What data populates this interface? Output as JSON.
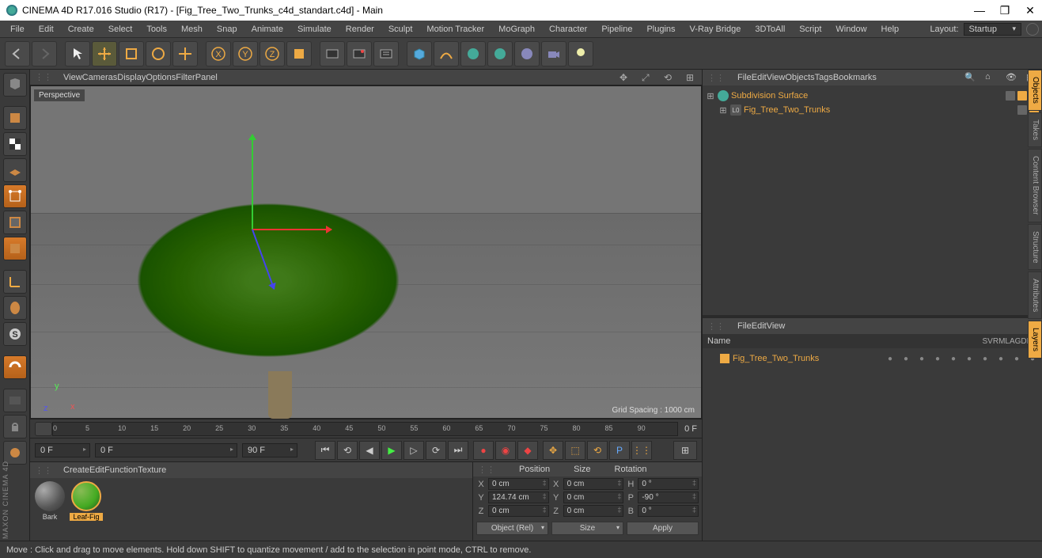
{
  "title": "CINEMA 4D R17.016 Studio (R17) - [Fig_Tree_Two_Trunks_c4d_standart.c4d] - Main",
  "menu": [
    "File",
    "Edit",
    "Create",
    "Select",
    "Tools",
    "Mesh",
    "Snap",
    "Animate",
    "Simulate",
    "Render",
    "Sculpt",
    "Motion Tracker",
    "MoGraph",
    "Character",
    "Pipeline",
    "Plugins",
    "V-Ray Bridge",
    "3DToAll",
    "Script",
    "Window",
    "Help"
  ],
  "layout": {
    "label": "Layout:",
    "value": "Startup"
  },
  "viewport": {
    "menu": [
      "View",
      "Cameras",
      "Display",
      "Options",
      "Filter",
      "Panel"
    ],
    "label": "Perspective",
    "grid": "Grid Spacing : 1000 cm"
  },
  "timeline": {
    "ticks": [
      "0",
      "5",
      "10",
      "15",
      "20",
      "25",
      "30",
      "35",
      "40",
      "45",
      "50",
      "55",
      "60",
      "65",
      "70",
      "75",
      "80",
      "85",
      "90"
    ],
    "end_label": "0 F",
    "start": "0 F",
    "slider_start": "0 F",
    "slider_end": "90 F"
  },
  "objects_menu": [
    "File",
    "Edit",
    "View",
    "Objects",
    "Tags",
    "Bookmarks"
  ],
  "objects": [
    {
      "name": "Subdivision Surface",
      "sel": true,
      "icon": "subdiv"
    },
    {
      "name": "Fig_Tree_Two_Trunks",
      "sel": true,
      "icon": "lo",
      "indent": 1
    }
  ],
  "layers_menu": [
    "File",
    "Edit",
    "View"
  ],
  "layers_hdr_name": "Name",
  "layers_cols": [
    "S",
    "V",
    "R",
    "M",
    "L",
    "A",
    "G",
    "D",
    "E",
    "X"
  ],
  "layers": [
    {
      "name": "Fig_Tree_Two_Trunks"
    }
  ],
  "materials_menu": [
    "Create",
    "Edit",
    "Function",
    "Texture"
  ],
  "materials": [
    {
      "name": "Bark",
      "cls": "bark"
    },
    {
      "name": "Leaf-Fig",
      "cls": "leaf",
      "sel": true
    }
  ],
  "coords": {
    "hdr": [
      "Position",
      "Size",
      "Rotation"
    ],
    "rows": [
      {
        "l": "X",
        "p": "0 cm",
        "s": "0 cm",
        "r": "0 °",
        "rl": "H"
      },
      {
        "l": "Y",
        "p": "124.74 cm",
        "s": "0 cm",
        "r": "-90 °",
        "rl": "P"
      },
      {
        "l": "Z",
        "p": "0 cm",
        "s": "0 cm",
        "r": "0 °",
        "rl": "B"
      }
    ],
    "mode": "Object (Rel)",
    "sizemode": "Size",
    "apply": "Apply"
  },
  "vtabs": [
    "Objects",
    "Takes",
    "Content Browser",
    "Structure",
    "Attributes",
    "Layers"
  ],
  "status": "Move : Click and drag to move elements. Hold down SHIFT to quantize movement / add to the selection in point mode, CTRL to remove.",
  "brand": "MAXON CINEMA 4D"
}
